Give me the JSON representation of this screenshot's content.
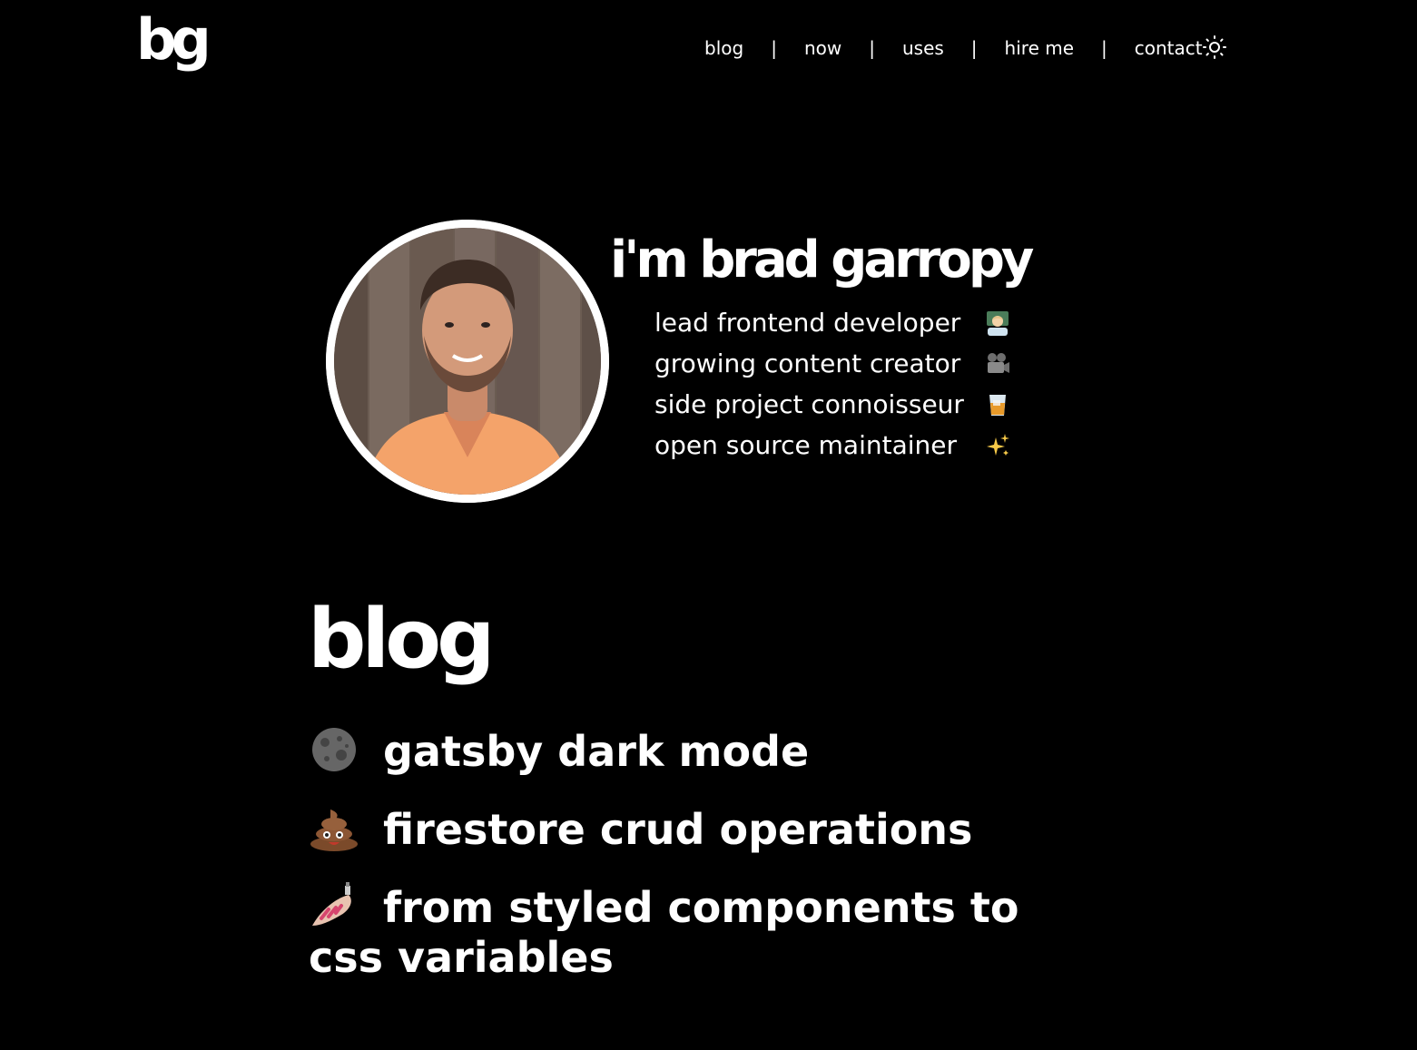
{
  "header": {
    "logo_text": "bg",
    "nav": [
      {
        "label": "blog"
      },
      {
        "label": "now"
      },
      {
        "label": "uses"
      },
      {
        "label": "hire me"
      },
      {
        "label": "contact"
      }
    ],
    "separator": "|",
    "theme_toggle_icon": "sun-icon"
  },
  "hero": {
    "title": "i'm brad garropy",
    "avatar_alt": "profile-photo",
    "roles": [
      {
        "label": "lead frontend developer",
        "icon": "technologist-emoji"
      },
      {
        "label": "growing content creator",
        "icon": "movie-camera-emoji"
      },
      {
        "label": "side project connoisseur",
        "icon": "whiskey-glass-emoji"
      },
      {
        "label": "open source maintainer",
        "icon": "sparkles-emoji"
      }
    ]
  },
  "blog": {
    "heading": "blog",
    "posts": [
      {
        "icon": "moon-emoji",
        "title": "gatsby dark mode"
      },
      {
        "icon": "poop-emoji",
        "title": "firestore crud operations"
      },
      {
        "icon": "nail-polish-emoji",
        "title": "from styled components to css variables"
      }
    ]
  },
  "colors": {
    "background": "#000000",
    "text": "#ffffff"
  }
}
